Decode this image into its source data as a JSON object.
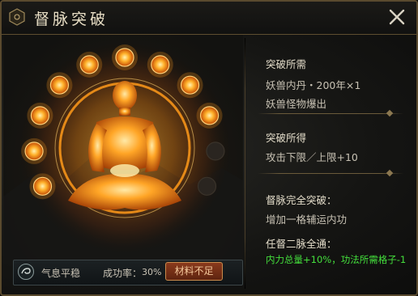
{
  "window": {
    "title": "督脉突破",
    "emblem_icon": "meridian-emblem-icon",
    "close_icon": "close-icon"
  },
  "art": {
    "meridian_nodes_lit": 9,
    "meridian_nodes_total": 11,
    "glow_color": "#ff9a1a",
    "node_color": "#ffb02a",
    "dim_node_color": "#2a2520"
  },
  "status": {
    "icon": "qi-swirl-icon",
    "state": "气息平稳",
    "rate_label": "成功率：",
    "rate_value": "30%",
    "button_label": "材料不足"
  },
  "info": {
    "requirements": {
      "title": "突破所需",
      "item": "妖兽内丹・200年×1",
      "source": "妖兽怪物爆出"
    },
    "rewards": {
      "title": "突破所得",
      "line": "攻击下限／上限+10"
    },
    "full_breakthrough": {
      "title": "督脉完全突破：",
      "line": "增加一格辅运内功"
    },
    "both_meridians": {
      "title": "任督二脉全通：",
      "line": "内力总量+10%，功法所需格子-1"
    }
  },
  "colors": {
    "border": "#5a4a2e",
    "highlight_green": "#44e03c",
    "button_bg": "#8a3a1c"
  }
}
